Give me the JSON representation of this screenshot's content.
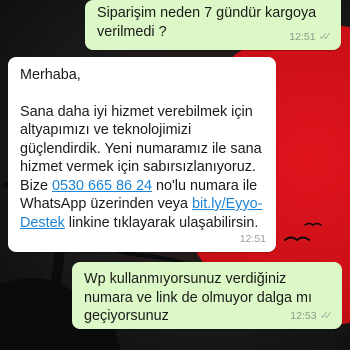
{
  "messages": [
    {
      "text": "Siparişim neden 7 gündür kargoya verilmedi ?",
      "time": "12:51"
    },
    {
      "greeting": "Merhaba,",
      "body_1": "Sana daha iyi hizmet verebilmek için altyapımızı ve teknolojimizi güçlendirdik. Yeni numaramız ile sana hizmet vermek için sabırsızlanıyoruz. Bize ",
      "phone": "0530 665 86 24",
      "body_2": " no'lu numara ile WhatsApp üzerinden veya ",
      "link": "bit.ly/Eyyo-Destek",
      "body_3": " linkine tıklayarak ulaşabilirsin.",
      "time": "12:51"
    },
    {
      "text": "Wp kullanmıyorsunuz verdiğiniz numara ve link de olmuyor dalga mı geçiyorsunuz",
      "time": "12:53"
    }
  ],
  "colors": {
    "outgoing_bubble": "#dcf8c6",
    "incoming_bubble": "#ffffff",
    "link": "#1d83d4",
    "wallpaper_moon": "#d3111a"
  },
  "icons": {
    "read_receipt": "double-check-icon"
  }
}
